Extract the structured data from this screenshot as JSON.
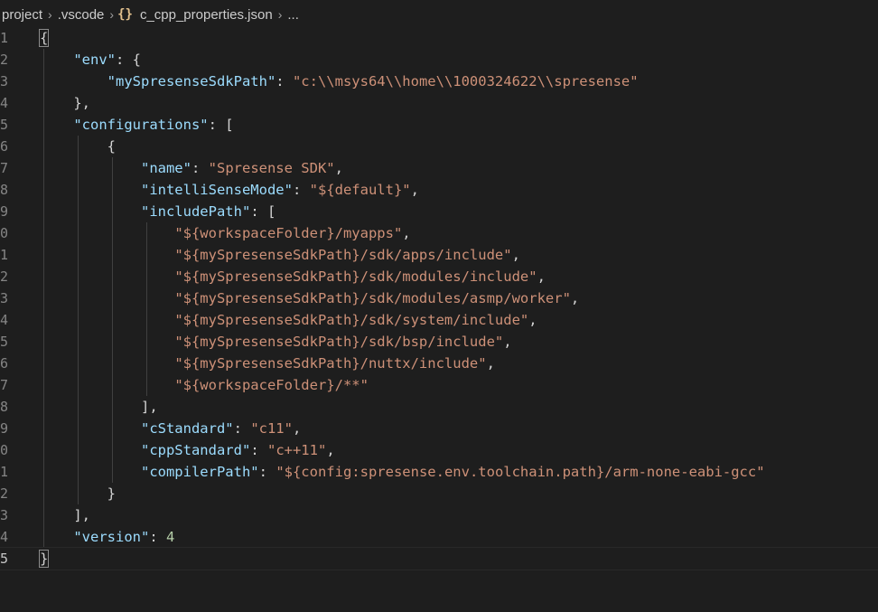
{
  "breadcrumb": {
    "project": "project",
    "folder": ".vscode",
    "icon": "{}",
    "file": "c_cpp_properties.json",
    "ellipsis": "..."
  },
  "line_numbers": [
    "1",
    "2",
    "3",
    "4",
    "5",
    "6",
    "7",
    "8",
    "9",
    "0",
    "1",
    "2",
    "3",
    "4",
    "5",
    "6",
    "7",
    "8",
    "9",
    "0",
    "1",
    "2",
    "3",
    "4",
    "5"
  ],
  "code": {
    "open_brace": "{",
    "env_key": "\"env\"",
    "sdk_path_key": "\"mySpresenseSdkPath\"",
    "sdk_path_value": "\"c:\\\\msys64\\\\home\\\\1000324622\\\\spresense\"",
    "configurations_key": "\"configurations\"",
    "name_key": "\"name\"",
    "name_value": "\"Spresense SDK\"",
    "intellisense_key": "\"intelliSenseMode\"",
    "intellisense_value": "\"${default}\"",
    "include_key": "\"includePath\"",
    "include_paths": [
      "\"${workspaceFolder}/myapps\"",
      "\"${mySpresenseSdkPath}/sdk/apps/include\"",
      "\"${mySpresenseSdkPath}/sdk/modules/include\"",
      "\"${mySpresenseSdkPath}/sdk/modules/asmp/worker\"",
      "\"${mySpresenseSdkPath}/sdk/system/include\"",
      "\"${mySpresenseSdkPath}/sdk/bsp/include\"",
      "\"${mySpresenseSdkPath}/nuttx/include\"",
      "\"${workspaceFolder}/**\""
    ],
    "cstandard_key": "\"cStandard\"",
    "cstandard_value": "\"c11\"",
    "cppstandard_key": "\"cppStandard\"",
    "cppstandard_value": "\"c++11\"",
    "compiler_key": "\"compilerPath\"",
    "compiler_value": "\"${config:spresense.env.toolchain.path}/arm-none-eabi-gcc\"",
    "version_key": "\"version\"",
    "version_value": "4",
    "close_brace": "}"
  },
  "colors": {
    "background": "#1e1e1e",
    "key": "#9cdcfe",
    "string": "#ce9178",
    "number": "#b5cea8",
    "punctuation": "#d4d4d4",
    "line_number": "#858585"
  },
  "icons": {
    "chevron": "chevron-right-icon",
    "json_file": "json-file-icon"
  }
}
